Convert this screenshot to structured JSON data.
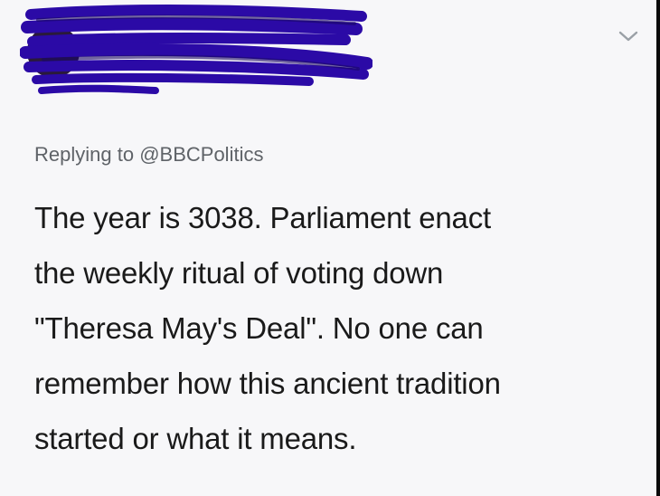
{
  "tweet": {
    "author": {
      "display_name": "",
      "handle": "",
      "redacted": true,
      "redaction_color": "#2b0aa6"
    },
    "menu_icon": "chevron-down-icon",
    "reply": {
      "prefix": "Replying to",
      "handle": "@BBCPolitics"
    },
    "text_lines": [
      "The year is 3038. Parliament enact",
      "the weekly ritual of voting down",
      "\"Theresa May's Deal\". No one can",
      "remember how this ancient tradition",
      "started or what it means."
    ]
  },
  "colors": {
    "background": "#f7f7f9",
    "text": "#1a1a1a",
    "secondary_text": "#5f6368",
    "chevron": "#9aa0a6"
  }
}
